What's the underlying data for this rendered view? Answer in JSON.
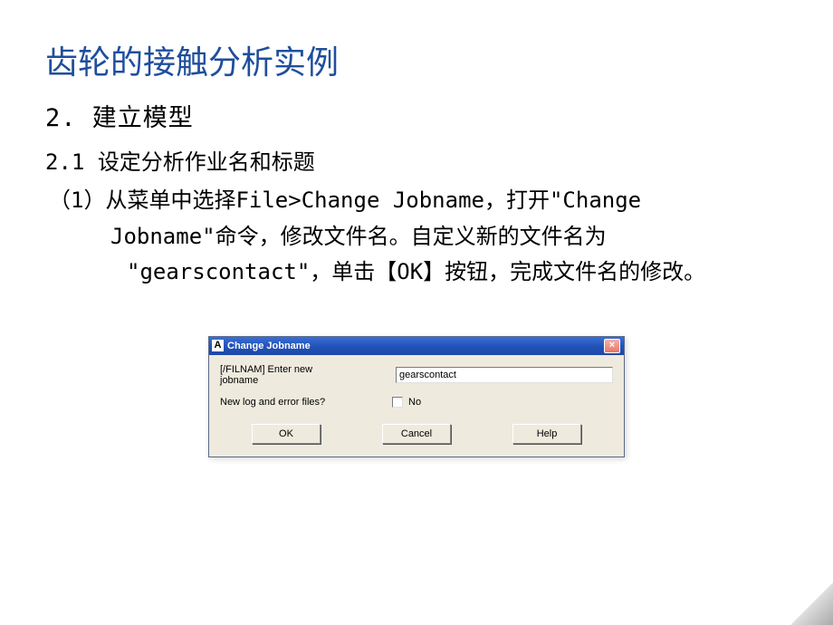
{
  "title": "齿轮的接触分析实例",
  "section": {
    "number": "2.",
    "heading": "建立模型",
    "sub_number": "2.1",
    "sub_heading": "设定分析作业名和标题",
    "para_line1": "（1）从菜单中选择File>Change Jobname，打开\"Change",
    "para_line2": "Jobname\"命令，修改文件名。自定义新的文件名为",
    "para_line3": "\"gearscontact\"，单击【OK】按钮，完成文件名的修改。"
  },
  "dialog": {
    "icon_letter": "A",
    "title": "Change Jobname",
    "label_filnam": "[/FILNAM] Enter new jobname",
    "input_value": "gearscontact",
    "label_newlog": "New log and error files?",
    "checkbox_label": "No",
    "buttons": {
      "ok": "OK",
      "cancel": "Cancel",
      "help": "Help"
    },
    "close_symbol": "×"
  }
}
